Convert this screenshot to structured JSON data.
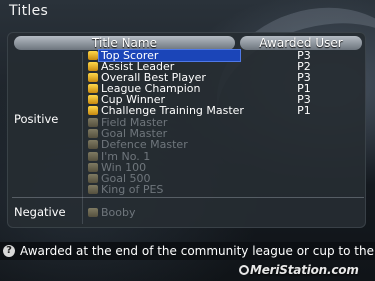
{
  "screen": {
    "title": "Titles"
  },
  "table": {
    "col_title": "Title Name",
    "col_user": "Awarded User",
    "categories": {
      "positive": "Positive",
      "negative": "Negative"
    },
    "rows": [
      {
        "name": "Top Scorer",
        "user": "P3",
        "awarded": true,
        "selected": true,
        "icon": "crown-icon"
      },
      {
        "name": "Assist Leader",
        "user": "P2",
        "awarded": true,
        "icon": "boots-icon"
      },
      {
        "name": "Overall Best Player",
        "user": "P3",
        "awarded": true,
        "icon": "mvp-icon"
      },
      {
        "name": "League Champion",
        "user": "P1",
        "awarded": true,
        "icon": "trophy-icon"
      },
      {
        "name": "Cup Winner",
        "user": "P3",
        "awarded": true,
        "icon": "cup-icon"
      },
      {
        "name": "Challenge Training Master",
        "user": "P1",
        "awarded": true,
        "icon": "cone-icon"
      },
      {
        "name": "Field Master",
        "user": "",
        "awarded": false,
        "icon": "field-icon"
      },
      {
        "name": "Goal Master",
        "user": "",
        "awarded": false,
        "icon": "goal-icon"
      },
      {
        "name": "Defence Master",
        "user": "",
        "awarded": false,
        "icon": "shield-icon"
      },
      {
        "name": "I'm No. 1",
        "user": "",
        "awarded": false,
        "icon": "number-one-icon"
      },
      {
        "name": "Win 100",
        "user": "",
        "awarded": false,
        "icon": "win-icon"
      },
      {
        "name": "Goal 500",
        "user": "",
        "awarded": false,
        "icon": "ball-icon"
      },
      {
        "name": "King of PES",
        "user": "",
        "awarded": false,
        "icon": "king-icon"
      }
    ],
    "negative_rows": [
      {
        "name": "Booby",
        "user": "",
        "awarded": false,
        "icon": "booby-icon"
      }
    ]
  },
  "help": {
    "icon_glyph": "?",
    "text": "Awarded at the end of the community league or cup to the"
  },
  "watermark": {
    "text": "MeriStation.com"
  }
}
